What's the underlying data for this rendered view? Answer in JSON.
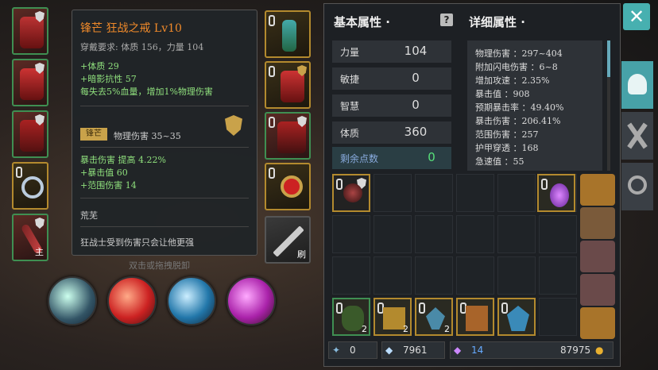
{
  "tooltip": {
    "title": "锋芒 狂战之戒 Lv10",
    "requirement": "穿戴要求:  体质 156，力量 104",
    "bonus1": "+体质 29",
    "bonus2": "+暗影抗性 57",
    "bonus3": "每失去5%血量，增加1%物理伤害",
    "badge": "锋芒",
    "phys": "物理伤害 35~35",
    "crit1": "暴击伤害 提高 4.22%",
    "crit2": "+暴击值 60",
    "crit3": "+范围伤害 14",
    "quality": "荒芜",
    "flavor": "狂战士受到伤害只会让他更强"
  },
  "hint": "双击或拖拽脱卸",
  "slot_tags": {
    "main": "主",
    "refresh": "刷"
  },
  "basic": {
    "header": "基本属性 ·",
    "rows": [
      {
        "label": "力量",
        "value": "104"
      },
      {
        "label": "敏捷",
        "value": "0"
      },
      {
        "label": "智慧",
        "value": "0"
      },
      {
        "label": "体质",
        "value": "360"
      }
    ],
    "remain_label": "剩余点数",
    "remain_value": "0"
  },
  "help_icon": "?",
  "detail": {
    "header": "详细属性 ·",
    "lines": [
      "物理伤害 ：297~404",
      "附加闪电伤害 ：6~8",
      "增加攻速 ：2.35%",
      "暴击值 ：908",
      "预期暴击率 ：49.40%",
      "暴击伤害 ：206.41%",
      "范围伤害 ：257",
      "护甲穿透 ：168",
      "急速值 ：55"
    ]
  },
  "inventory_counts": [
    "2",
    "2",
    "2"
  ],
  "currency": {
    "a": "0",
    "b": "7961",
    "c": "14",
    "d": "87975"
  },
  "close": "✕",
  "colors": {
    "accent": "#47b0b0",
    "item_title": "#f08a2a",
    "bonus": "#8fe07d",
    "remain": "#57e07a"
  }
}
